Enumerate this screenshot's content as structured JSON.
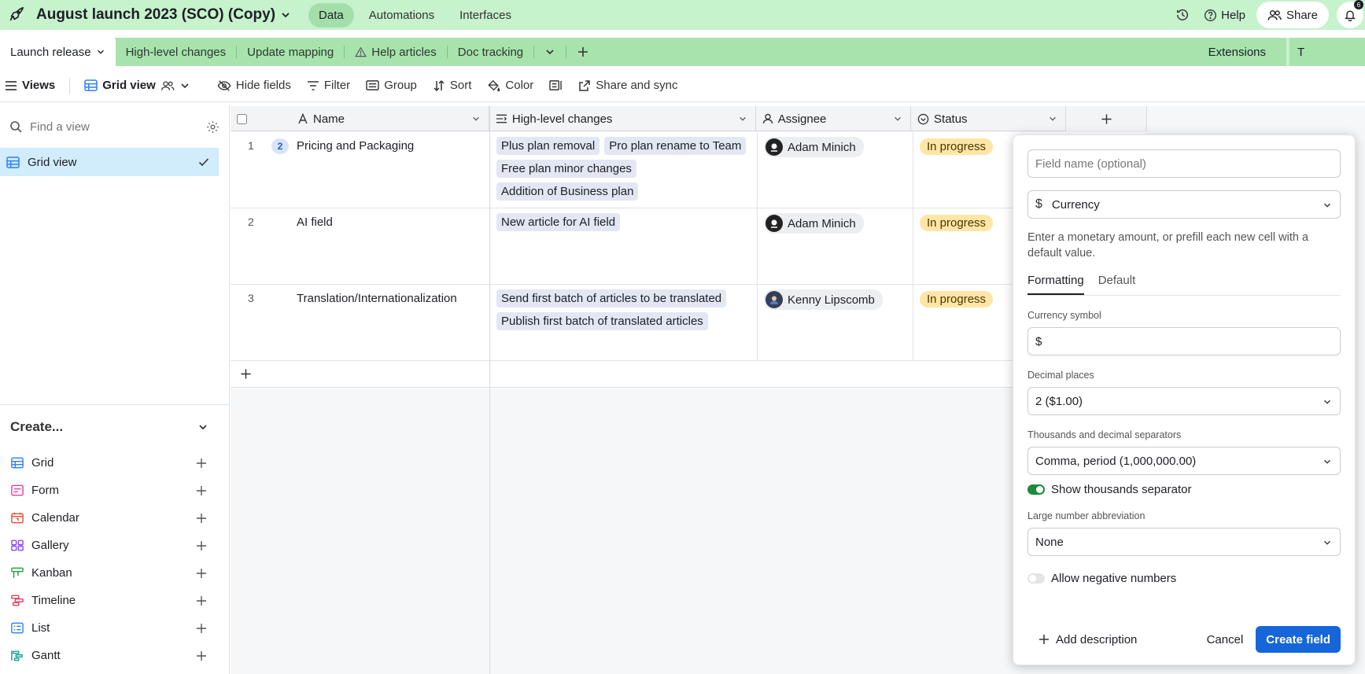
{
  "app": {
    "base_title": "August launch 2023 (SCO) (Copy)",
    "nav": [
      "Data",
      "Automations",
      "Interfaces"
    ],
    "help_label": "Help",
    "share_label": "Share",
    "notification_count": "6"
  },
  "tables": {
    "active": "Launch release",
    "items": [
      "High-level changes",
      "Update mapping",
      "Help articles",
      "Doc tracking"
    ],
    "extensions_label": "Extensions",
    "tools_label": "T"
  },
  "viewbar": {
    "views_label": "Views",
    "view_name": "Grid view",
    "hide_fields": "Hide fields",
    "filter": "Filter",
    "group": "Group",
    "sort": "Sort",
    "color": "Color",
    "share_sync": "Share and sync"
  },
  "sidebar": {
    "find_placeholder": "Find a view",
    "views": [
      {
        "label": "Grid view"
      }
    ],
    "create_label": "Create...",
    "create_items": [
      "Grid",
      "Form",
      "Calendar",
      "Gallery",
      "Kanban",
      "Timeline",
      "List",
      "Gantt"
    ],
    "colors": {
      "grid": "#2d7ff9",
      "form": "#e541a1",
      "calendar": "#e54e34",
      "gallery": "#8b46ff",
      "kanban": "#21a13d",
      "timeline": "#e4405f",
      "list": "#2d7ff9",
      "gantt": "#11a08f"
    }
  },
  "grid": {
    "columns": [
      "Name",
      "High-level changes",
      "Assignee",
      "Status"
    ],
    "rows": [
      {
        "num": "1",
        "comment_count": "2",
        "name": "Pricing and Packaging",
        "changes": [
          "Plus plan removal",
          "Pro plan rename to Team",
          "Free plan minor changes",
          "Addition of Business plan"
        ],
        "assignee": "Adam Minich",
        "status": "In progress"
      },
      {
        "num": "2",
        "name": "AI field",
        "changes": [
          "New article for AI field"
        ],
        "assignee": "Adam Minich",
        "status": "In progress"
      },
      {
        "num": "3",
        "name": "Translation/Internationalization",
        "changes": [
          "Send first batch of articles to be translated",
          "Publish first batch of translated articles"
        ],
        "assignee": "Kenny Lipscomb",
        "status": "In progress"
      }
    ]
  },
  "panel": {
    "field_name_placeholder": "Field name (optional)",
    "field_type": "Currency",
    "description": "Enter a monetary amount, or prefill each new cell with a default value.",
    "tabs": [
      "Formatting",
      "Default"
    ],
    "currency_symbol_label": "Currency symbol",
    "currency_symbol_value": "$",
    "decimal_places_label": "Decimal places",
    "decimal_places_value": "2 ($1.00)",
    "separators_label": "Thousands and decimal separators",
    "separators_value": "Comma, period (1,000,000.00)",
    "show_thousands_label": "Show thousands separator",
    "show_thousands_on": true,
    "abbreviation_label": "Large number abbreviation",
    "abbreviation_value": "None",
    "allow_negative_label": "Allow negative numbers",
    "allow_negative_on": false,
    "add_description": "Add description",
    "cancel": "Cancel",
    "create_field": "Create field"
  },
  "colors": {
    "topbar": "#c6f2cc",
    "tabbar": "#a8e3ae",
    "primary_button": "#1666d9",
    "status_in_progress": "#ffe6a6",
    "selected_view": "#d1ecfb"
  }
}
